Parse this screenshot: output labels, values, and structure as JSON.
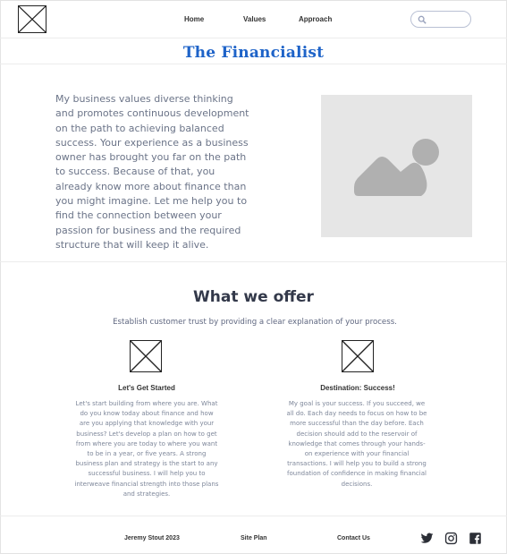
{
  "header": {
    "logo_icon": "image-placeholder-icon",
    "nav": [
      "Home",
      "Values",
      "Approach"
    ],
    "search": {
      "placeholder": "",
      "icon": "search-icon"
    }
  },
  "brand": {
    "name": "The Financialist",
    "color": "#1e63c8"
  },
  "intro": {
    "paragraph": "My business values diverse thinking and promotes continuous development on the path to achieving balanced success. Your experience as a business owner has brought you far on the path to success. Because of that, you already know more about finance than you might imagine.  Let me help you to find the connection between your passion for business and the required structure that will keep it alive.",
    "image_icon": "image-icon"
  },
  "offer": {
    "title": "What we offer",
    "subtitle": "Establish customer trust by providing a clear explanation of your process.",
    "cards": [
      {
        "icon": "image-placeholder-icon",
        "title": "Let's Get Started",
        "text": "Let's start building from where you are. What do you know today about finance and how are you applying that knowledge with your business? Let's develop a plan on how to get from where you are today to where you want to be in a year, or five years.  A strong business plan and strategy is the start to any successful business. I will help you to interweave financial strength into those plans and strategies."
      },
      {
        "icon": "image-placeholder-icon",
        "title": "Destination: Success!",
        "text": "My goal is your success.  If you succeed, we all do. Each day needs to focus on how to be more successful than the day before. Each decision should add to the reservoir of knowledge that comes through your hands-on experience with your financial transactions. I will help you to build a strong foundation of confidence in making financial decisions."
      }
    ]
  },
  "footer": {
    "copyright": "Jeremy Stout 2023",
    "site_plan": "Site Plan",
    "contact": "Contact Us",
    "social_icons": [
      "twitter-icon",
      "instagram-icon",
      "facebook-icon"
    ]
  }
}
